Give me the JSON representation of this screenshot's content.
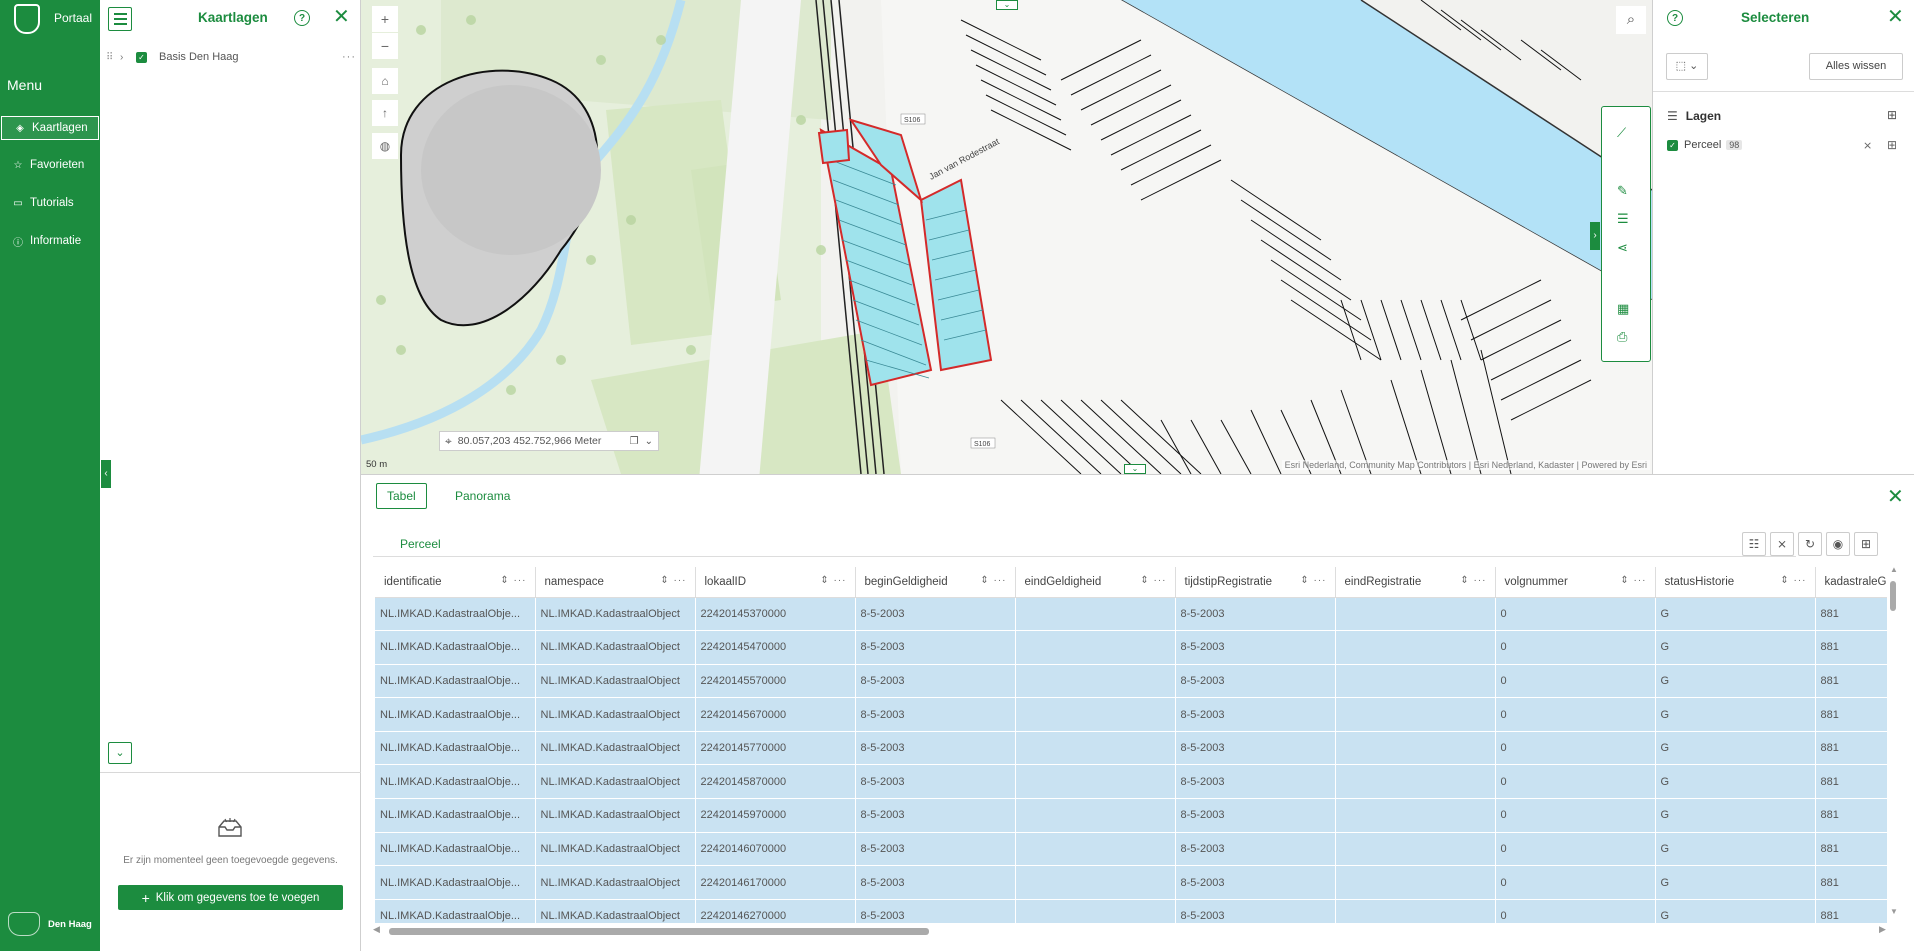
{
  "nav": {
    "portal_label": "Portaal",
    "menu_label": "Menu",
    "items": [
      {
        "label": "Kaartlagen",
        "icon": "layers-icon"
      },
      {
        "label": "Favorieten",
        "icon": "star-icon"
      },
      {
        "label": "Tutorials",
        "icon": "monitor-icon"
      },
      {
        "label": "Informatie",
        "icon": "info-icon"
      }
    ],
    "footer_label": "Den Haag"
  },
  "layer_panel": {
    "title": "Kaartlagen",
    "layer_name": "Basis Den Haag",
    "empty_text": "Er zijn momenteel geen toegevoegde gegevens.",
    "add_button": "Klik om gegevens toe te voegen"
  },
  "map": {
    "coordinates": "80.057,203 452.752,966 Meter",
    "scale": "50 m",
    "attribution": "Esri Nederland, Community Map Contributors | Esri Nederland, Kadaster | Powered by Esri",
    "street_labels": [
      "Jan van Rodestraat",
      "S106",
      "S106"
    ]
  },
  "select_panel": {
    "title": "Selecteren",
    "clear_button": "Alles wissen",
    "layers_header": "Lagen",
    "layer_name": "Perceel",
    "layer_count": "98"
  },
  "table_panel": {
    "tabs": [
      "Tabel",
      "Panorama"
    ],
    "subtab": "Perceel",
    "columns": [
      "identificatie",
      "namespace",
      "lokaalID",
      "beginGeldigheid",
      "eindGeldigheid",
      "tijdstipRegistratie",
      "eindRegistratie",
      "volgnummer",
      "statusHistorie",
      "kadastraleG"
    ],
    "rows": [
      [
        "NL.IMKAD.KadastraalObje...",
        "NL.IMKAD.KadastraalObject",
        "22420145370000",
        "8-5-2003",
        "",
        "8-5-2003",
        "",
        "0",
        "G",
        "881"
      ],
      [
        "NL.IMKAD.KadastraalObje...",
        "NL.IMKAD.KadastraalObject",
        "22420145470000",
        "8-5-2003",
        "",
        "8-5-2003",
        "",
        "0",
        "G",
        "881"
      ],
      [
        "NL.IMKAD.KadastraalObje...",
        "NL.IMKAD.KadastraalObject",
        "22420145570000",
        "8-5-2003",
        "",
        "8-5-2003",
        "",
        "0",
        "G",
        "881"
      ],
      [
        "NL.IMKAD.KadastraalObje...",
        "NL.IMKAD.KadastraalObject",
        "22420145670000",
        "8-5-2003",
        "",
        "8-5-2003",
        "",
        "0",
        "G",
        "881"
      ],
      [
        "NL.IMKAD.KadastraalObje...",
        "NL.IMKAD.KadastraalObject",
        "22420145770000",
        "8-5-2003",
        "",
        "8-5-2003",
        "",
        "0",
        "G",
        "881"
      ],
      [
        "NL.IMKAD.KadastraalObje...",
        "NL.IMKAD.KadastraalObject",
        "22420145870000",
        "8-5-2003",
        "",
        "8-5-2003",
        "",
        "0",
        "G",
        "881"
      ],
      [
        "NL.IMKAD.KadastraalObje...",
        "NL.IMKAD.KadastraalObject",
        "22420145970000",
        "8-5-2003",
        "",
        "8-5-2003",
        "",
        "0",
        "G",
        "881"
      ],
      [
        "NL.IMKAD.KadastraalObje...",
        "NL.IMKAD.KadastraalObject",
        "22420146070000",
        "8-5-2003",
        "",
        "8-5-2003",
        "",
        "0",
        "G",
        "881"
      ],
      [
        "NL.IMKAD.KadastraalObje...",
        "NL.IMKAD.KadastraalObject",
        "22420146170000",
        "8-5-2003",
        "",
        "8-5-2003",
        "",
        "0",
        "G",
        "881"
      ],
      [
        "NL.IMKAD.KadastraalObje...",
        "NL.IMKAD.KadastraalObject",
        "22420146270000",
        "8-5-2003",
        "",
        "8-5-2003",
        "",
        "0",
        "G",
        "881"
      ]
    ]
  },
  "colors": {
    "brand_green": "#1c8c3f",
    "selected_row": "#c9e2f2",
    "parcel_highlight": "#9fe3ec",
    "selection_outline": "#d42a2a",
    "canal": "#b3e2f7"
  }
}
